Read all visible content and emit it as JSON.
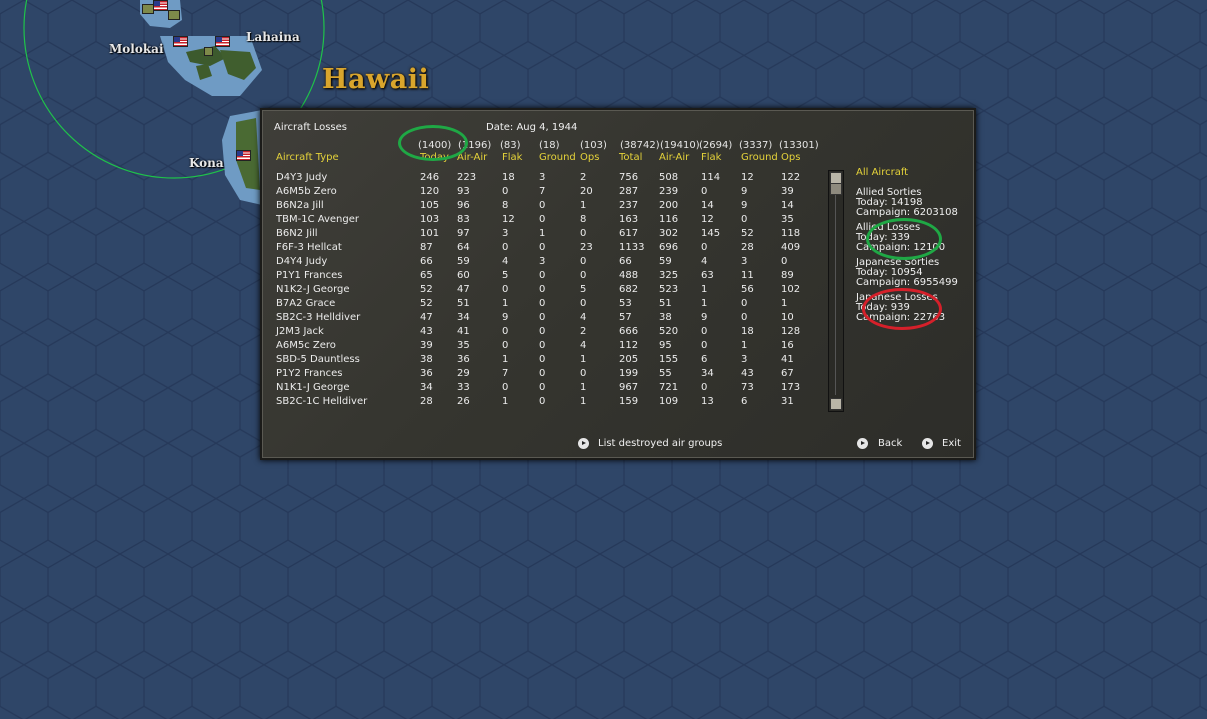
{
  "map": {
    "region_label": "Hawaii",
    "places": [
      "Molokai",
      "Lahaina",
      "Kona"
    ]
  },
  "dialog": {
    "title": "Aircraft Losses",
    "date": "Date: Aug 4, 1944",
    "totals": [
      "(1400)",
      "(1196)",
      "(83)",
      "(18)",
      "(103)",
      "(38742)",
      "(19410)",
      "(2694)",
      "(3337)",
      "(13301)"
    ],
    "col_aircraft_type": "Aircraft Type",
    "headers": [
      "Today",
      "Air-Air",
      "Flak",
      "Ground",
      "Ops",
      "Total",
      "Air-Air",
      "Flak",
      "Ground",
      "Ops"
    ],
    "rows": [
      {
        "name": "D4Y3 Judy",
        "v": [
          "246",
          "223",
          "18",
          "3",
          "2",
          "756",
          "508",
          "114",
          "12",
          "122"
        ]
      },
      {
        "name": "A6M5b Zero",
        "v": [
          "120",
          "93",
          "0",
          "7",
          "20",
          "287",
          "239",
          "0",
          "9",
          "39"
        ]
      },
      {
        "name": "B6N2a Jill",
        "v": [
          "105",
          "96",
          "8",
          "0",
          "1",
          "237",
          "200",
          "14",
          "9",
          "14"
        ]
      },
      {
        "name": "TBM-1C Avenger",
        "v": [
          "103",
          "83",
          "12",
          "0",
          "8",
          "163",
          "116",
          "12",
          "0",
          "35"
        ]
      },
      {
        "name": "B6N2 Jill",
        "v": [
          "101",
          "97",
          "3",
          "1",
          "0",
          "617",
          "302",
          "145",
          "52",
          "118"
        ]
      },
      {
        "name": "F6F-3 Hellcat",
        "v": [
          "87",
          "64",
          "0",
          "0",
          "23",
          "1133",
          "696",
          "0",
          "28",
          "409"
        ]
      },
      {
        "name": "D4Y4 Judy",
        "v": [
          "66",
          "59",
          "4",
          "3",
          "0",
          "66",
          "59",
          "4",
          "3",
          "0"
        ]
      },
      {
        "name": "P1Y1 Frances",
        "v": [
          "65",
          "60",
          "5",
          "0",
          "0",
          "488",
          "325",
          "63",
          "11",
          "89"
        ]
      },
      {
        "name": "N1K2-J George",
        "v": [
          "52",
          "47",
          "0",
          "0",
          "5",
          "682",
          "523",
          "1",
          "56",
          "102"
        ]
      },
      {
        "name": "B7A2 Grace",
        "v": [
          "52",
          "51",
          "1",
          "0",
          "0",
          "53",
          "51",
          "1",
          "0",
          "1"
        ]
      },
      {
        "name": "SB2C-3 Helldiver",
        "v": [
          "47",
          "34",
          "9",
          "0",
          "4",
          "57",
          "38",
          "9",
          "0",
          "10"
        ]
      },
      {
        "name": "J2M3 Jack",
        "v": [
          "43",
          "41",
          "0",
          "0",
          "2",
          "666",
          "520",
          "0",
          "18",
          "128"
        ]
      },
      {
        "name": "A6M5c Zero",
        "v": [
          "39",
          "35",
          "0",
          "0",
          "4",
          "112",
          "95",
          "0",
          "1",
          "16"
        ]
      },
      {
        "name": "SBD-5 Dauntless",
        "v": [
          "38",
          "36",
          "1",
          "0",
          "1",
          "205",
          "155",
          "6",
          "3",
          "41"
        ]
      },
      {
        "name": "P1Y2 Frances",
        "v": [
          "36",
          "29",
          "7",
          "0",
          "0",
          "199",
          "55",
          "34",
          "43",
          "67"
        ]
      },
      {
        "name": "N1K1-J George",
        "v": [
          "34",
          "33",
          "0",
          "0",
          "1",
          "967",
          "721",
          "0",
          "73",
          "173"
        ]
      },
      {
        "name": "SB2C-1C Helldiver",
        "v": [
          "28",
          "26",
          "1",
          "0",
          "1",
          "159",
          "109",
          "13",
          "6",
          "31"
        ]
      }
    ],
    "side": {
      "filter": "All Aircraft",
      "allied_sorties_label": "Allied Sorties",
      "allied_sorties_today": "Today:   14198",
      "allied_sorties_campaign": "Campaign: 6203108",
      "allied_losses_label": "Allied Losses",
      "allied_losses_today": "Today:   339",
      "allied_losses_campaign": "Campaign: 12100",
      "japanese_sorties_label": "Japanese Sorties",
      "japanese_sorties_today": "Today:   10954",
      "japanese_sorties_campaign": "Campaign: 6955499",
      "japanese_losses_label": "Japanese Losses",
      "japanese_losses_today": "Today:   939",
      "japanese_losses_campaign": "Campaign: 22763"
    },
    "buttons": {
      "destroyed_groups": "List destroyed air groups",
      "back": "Back",
      "exit": "Exit"
    }
  },
  "colors": {
    "header_yellow": "#e4d23a",
    "annotation_green": "#1fa845",
    "annotation_red": "#d5202a"
  }
}
